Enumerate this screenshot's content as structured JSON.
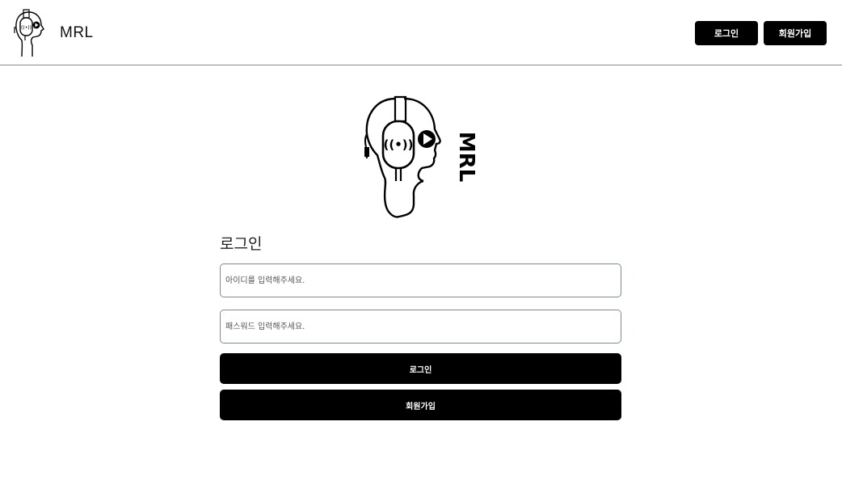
{
  "header": {
    "brand_name": "MRL",
    "login_label": "로그인",
    "signup_label": "회원가입"
  },
  "hero": {
    "logo_text": "MRL"
  },
  "login_form": {
    "title": "로그인",
    "id_placeholder": "아이디를 입력해주세요.",
    "password_placeholder": "패스워드 입력해주세요.",
    "login_label": "로그인",
    "signup_label": "회원가입"
  },
  "icons": {
    "brand_logo": "headphones-head-logo-icon",
    "hero_logo": "headphones-head-logo-icon"
  },
  "colors": {
    "primary": "#000000",
    "button_text": "#ffffff",
    "input_border": "#7d8a9a",
    "header_border": "#8a8a8a"
  }
}
